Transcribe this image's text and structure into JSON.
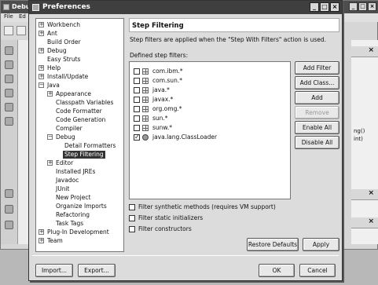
{
  "background_window": {
    "title": "Debu",
    "menu": [
      "File",
      "Ed"
    ],
    "winbtns": [
      "_",
      "□",
      "×"
    ],
    "right_panel": {
      "close": "×",
      "texts": [
        "ng()",
        "int)"
      ]
    }
  },
  "dialog": {
    "title": "Preferences",
    "winbtns": [
      "_",
      "□",
      "×"
    ]
  },
  "tree": {
    "items": [
      {
        "label": "Workbench",
        "toggle": "+"
      },
      {
        "label": "Ant",
        "toggle": "+"
      },
      {
        "label": "Build Order",
        "toggle": ""
      },
      {
        "label": "Debug",
        "toggle": "+"
      },
      {
        "label": "Easy Struts",
        "toggle": ""
      },
      {
        "label": "Help",
        "toggle": "+"
      },
      {
        "label": "Install/Update",
        "toggle": "+"
      },
      {
        "label": "Java",
        "toggle": "−"
      },
      {
        "label": "Appearance",
        "toggle": "+"
      },
      {
        "label": "Classpath Variables",
        "toggle": ""
      },
      {
        "label": "Code Formatter",
        "toggle": ""
      },
      {
        "label": "Code Generation",
        "toggle": ""
      },
      {
        "label": "Compiler",
        "toggle": ""
      },
      {
        "label": "Debug",
        "toggle": "−"
      },
      {
        "label": "Detail Formatters",
        "toggle": ""
      },
      {
        "label": "Step Filtering",
        "toggle": "",
        "selected": true
      },
      {
        "label": "Editor",
        "toggle": "+"
      },
      {
        "label": "Installed JREs",
        "toggle": ""
      },
      {
        "label": "Javadoc",
        "toggle": ""
      },
      {
        "label": "JUnit",
        "toggle": ""
      },
      {
        "label": "New Project",
        "toggle": ""
      },
      {
        "label": "Organize Imports",
        "toggle": ""
      },
      {
        "label": "Refactoring",
        "toggle": ""
      },
      {
        "label": "Task Tags",
        "toggle": ""
      },
      {
        "label": "Plug-In Development",
        "toggle": "+"
      },
      {
        "label": "Team",
        "toggle": "+"
      }
    ]
  },
  "page": {
    "title": "Step Filtering",
    "description": "Step filters are applied when the \"Step With Filters\" action is used.",
    "filters_label": "Defined step filters:",
    "filters": [
      {
        "text": "com.ibm.*",
        "checked": false,
        "icon": "package-icon"
      },
      {
        "text": "com.sun.*",
        "checked": false,
        "icon": "package-icon"
      },
      {
        "text": "java.*",
        "checked": false,
        "icon": "package-icon"
      },
      {
        "text": "javax.*",
        "checked": false,
        "icon": "package-icon"
      },
      {
        "text": "org.omg.*",
        "checked": false,
        "icon": "package-icon"
      },
      {
        "text": "sun.*",
        "checked": false,
        "icon": "package-icon"
      },
      {
        "text": "sunw.*",
        "checked": false,
        "icon": "package-icon"
      },
      {
        "text": "java.lang.ClassLoader",
        "checked": true,
        "icon": "class-icon"
      }
    ],
    "side_buttons": {
      "add_filter": "Add Filter",
      "add_class": "Add Class...",
      "add_packages": "Add Packages...",
      "remove": "Remove",
      "enable_all": "Enable All",
      "disable_all": "Disable All"
    },
    "options": [
      {
        "text": "Filter synthetic methods (requires VM support)",
        "checked": false
      },
      {
        "text": "Filter static initializers",
        "checked": false
      },
      {
        "text": "Filter constructors",
        "checked": false
      }
    ],
    "restore_defaults": "Restore Defaults",
    "apply": "Apply"
  },
  "footer": {
    "import": "Import...",
    "export": "Export...",
    "ok": "OK",
    "cancel": "Cancel"
  }
}
